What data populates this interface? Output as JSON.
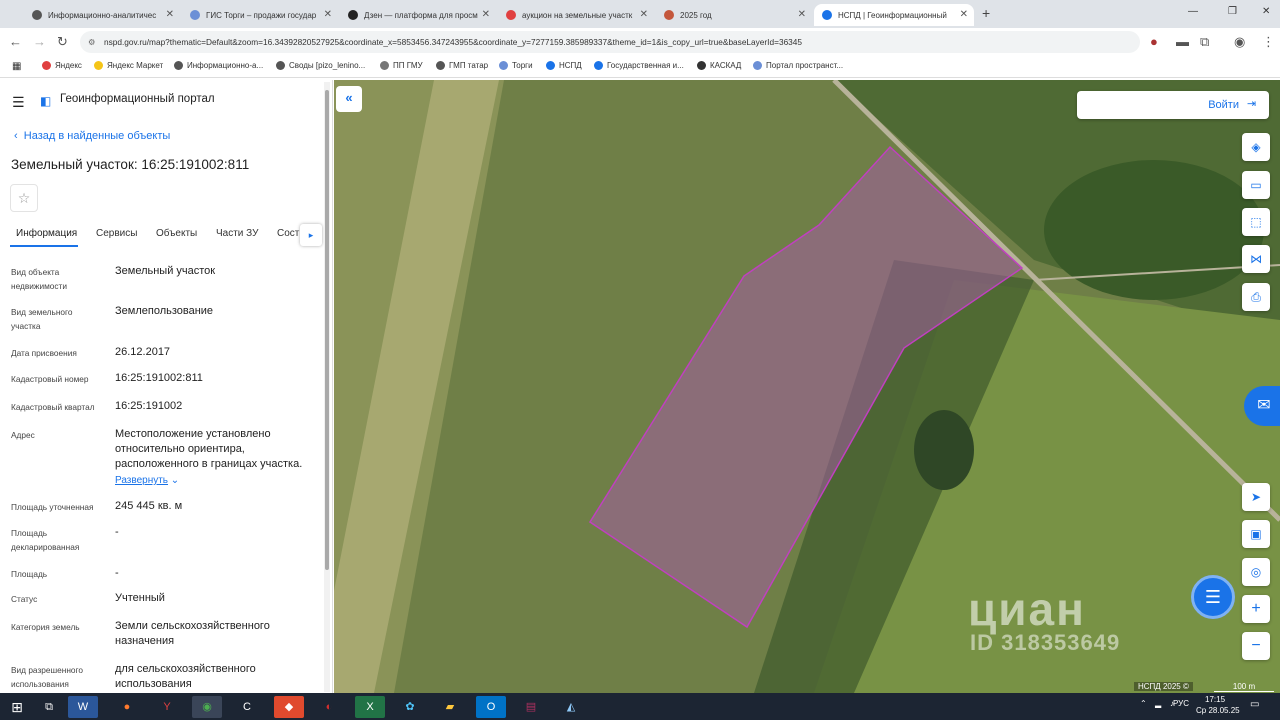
{
  "browser": {
    "tabs": [
      {
        "title": "Информационно-аналитичес",
        "color": "#555555"
      },
      {
        "title": "ГИС Торги – продажи государ",
        "color": "#6b8fd6"
      },
      {
        "title": "Дзен — платформа для просм",
        "color": "#222222"
      },
      {
        "title": "аукцион на земельные участк",
        "color": "#e04040"
      },
      {
        "title": "2025 год",
        "color": "#c4573c"
      },
      {
        "title": "НСПД | Геоинформационный",
        "color": "#1a73e8"
      }
    ],
    "url": "nspd.gov.ru/map?thematic=Default&zoom=16.34392820527925&coordinate_x=5853456.347243955&coordinate_y=7277159.385989337&theme_id=1&is_copy_url=true&baseLayerId=36345",
    "bookmarks": [
      {
        "label": "Яндекс",
        "color": "#e04040"
      },
      {
        "label": "Яндекс Маркет",
        "color": "#f5c518"
      },
      {
        "label": "Информационно-а...",
        "color": "#555555"
      },
      {
        "label": "Своды [pizo_lenino...",
        "color": "#555555"
      },
      {
        "label": "ПП ГМУ",
        "color": "#777777"
      },
      {
        "label": "ГМП татар",
        "color": "#555555"
      },
      {
        "label": "Торги",
        "color": "#6b8fd6"
      },
      {
        "label": "НСПД",
        "color": "#1a73e8"
      },
      {
        "label": "Государственная и...",
        "color": "#1a73e8"
      },
      {
        "label": "КАСКАД",
        "color": "#333333"
      },
      {
        "label": "Портал пространст...",
        "color": "#6b8fd6"
      }
    ]
  },
  "portal": {
    "title": "Геоинформационный портал",
    "back_label": "Назад в найденные объекты",
    "object_title": "Земельный участок: 16:25:191002:811",
    "tabs": [
      "Информация",
      "Сервисы",
      "Объекты",
      "Части ЗУ",
      "Сост"
    ],
    "expand_label": "Развернуть",
    "rows": [
      {
        "label": "Вид объекта недвижимости",
        "value": "Земельный участок"
      },
      {
        "label": "Вид земельного участка",
        "value": "Землепользование"
      },
      {
        "label": "Дата присвоения",
        "value": "26.12.2017"
      },
      {
        "label": "Кадастровый номер",
        "value": "16:25:191002:811"
      },
      {
        "label": "Кадастровый квартал",
        "value": "16:25:191002"
      },
      {
        "label": "Адрес",
        "value": "Местоположение установлено относительно ориентира, расположенного в границах участка."
      },
      {
        "label": "Площадь уточненная",
        "value": "245 445 кв. м"
      },
      {
        "label": "Площадь декларированная",
        "value": "-"
      },
      {
        "label": "Площадь",
        "value": "-"
      },
      {
        "label": "Статус",
        "value": "Учтенный"
      },
      {
        "label": "Категория земель",
        "value": "Земли сельскохозяйственного назначения"
      },
      {
        "label": "Вид разрешенного использования",
        "value": "для сельскохозяйственного использования"
      }
    ]
  },
  "map": {
    "login_label": "Войти",
    "watermark": "циан",
    "watermark_id": "ID 318353649",
    "footer_left": "НСПД 2025 ©",
    "footer_scale": "100 m",
    "parcel_color": "#c040c0"
  },
  "taskbar": {
    "lang": "РУС",
    "time": "17:15",
    "date": "Ср 28.05.25"
  }
}
